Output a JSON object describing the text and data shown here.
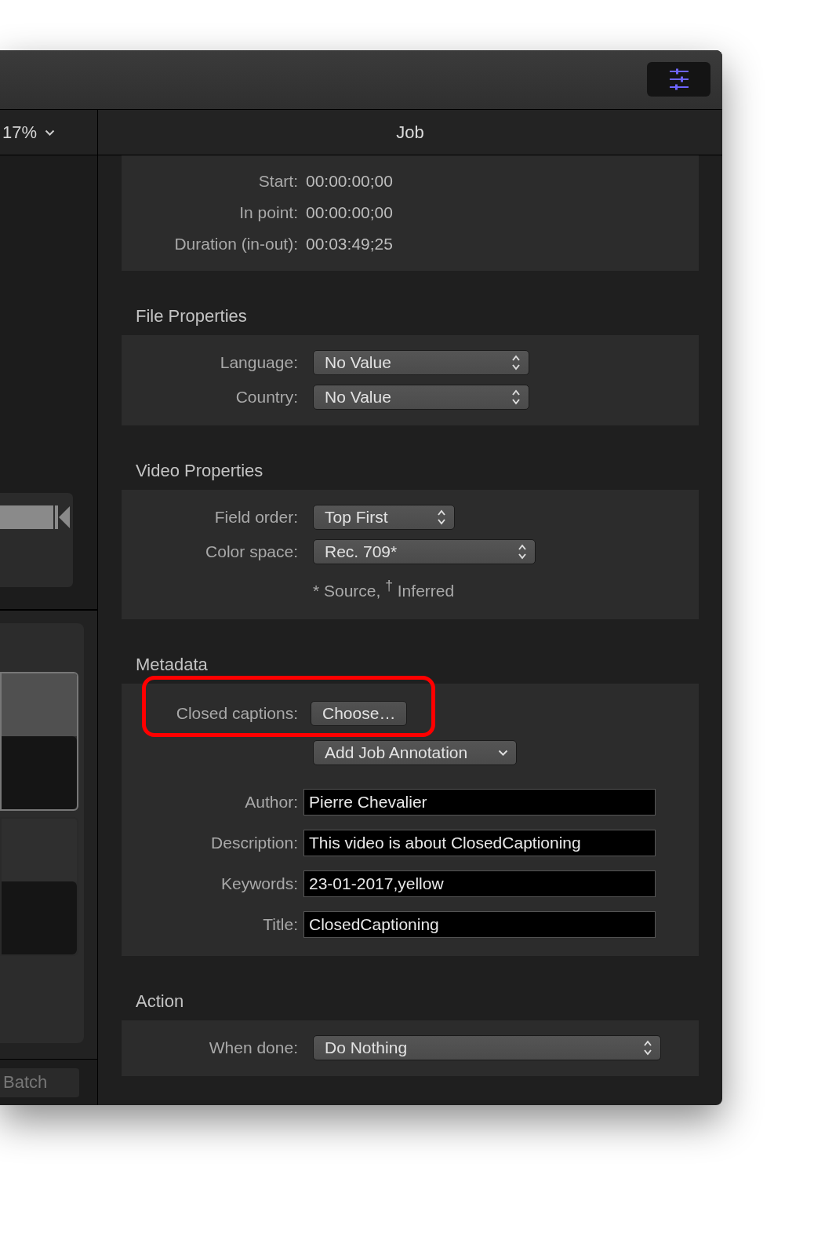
{
  "left_panel": {
    "zoom": "17%",
    "batch_button": "Batch"
  },
  "inspector": {
    "title": "Job",
    "sections": [
      {
        "rows": [
          {
            "kind": "value",
            "label": "Start:",
            "value": "00:00:00;00"
          },
          {
            "kind": "value",
            "label": "In point:",
            "value": "00:00:00;00"
          },
          {
            "kind": "value",
            "label": "Duration (in-out):",
            "value": "00:03:49;25"
          }
        ]
      },
      {
        "title": "File Properties",
        "rows": [
          {
            "kind": "popup",
            "label": "Language:",
            "value": "No Value"
          },
          {
            "kind": "popup",
            "label": "Country:",
            "value": "No Value"
          }
        ]
      },
      {
        "title": "Video Properties",
        "rows": [
          {
            "kind": "popup",
            "label": "Field order:",
            "value": "Top First"
          },
          {
            "kind": "popup",
            "label": "Color space:",
            "value": "Rec. 709*"
          },
          {
            "kind": "note",
            "value": "* Source, $^{†}$ Inferred"
          }
        ]
      },
      {
        "title": "Metadata",
        "rows": [
          {
            "kind": "button",
            "label": "Closed captions:",
            "value": "Choose…",
            "highlighted": true
          },
          {
            "kind": "menu",
            "value": "Add Job Annotation"
          },
          {
            "kind": "field",
            "label": "Author:",
            "value": "Pierre Chevalier"
          },
          {
            "kind": "field",
            "label": "Description:",
            "value": "This video is about ClosedCaptioning"
          },
          {
            "kind": "field",
            "label": "Keywords:",
            "value": "23-01-2017,yellow"
          },
          {
            "kind": "field",
            "label": "Title:",
            "value": "ClosedCaptioning"
          }
        ]
      },
      {
        "title": "Action",
        "rows": [
          {
            "kind": "popup",
            "label": "When done:",
            "value": "Do Nothing"
          }
        ]
      }
    ]
  }
}
